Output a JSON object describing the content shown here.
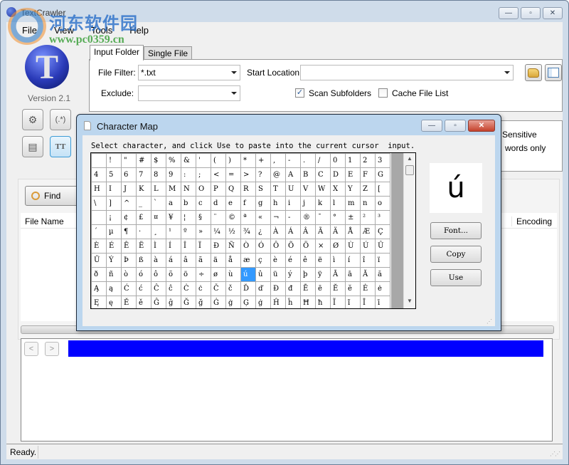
{
  "window": {
    "title": "TextCrawler",
    "minimize_label": "—",
    "maximize_label": "▫",
    "close_label": "✕"
  },
  "watermark": {
    "cn_text": "河东软件园",
    "url": "www.pc0359.cn"
  },
  "menu": [
    "File",
    "View",
    "Tools",
    "Help"
  ],
  "app": {
    "logo_letter": "T",
    "version": "Version 2.1"
  },
  "tools": [
    {
      "name": "settings",
      "glyph": "⚙"
    },
    {
      "name": "regex",
      "glyph": "(.*)"
    },
    {
      "name": "document",
      "glyph": "▤"
    },
    {
      "name": "character-map",
      "glyph": "TT"
    }
  ],
  "tabs": [
    {
      "label": "Input Folder",
      "active": true
    },
    {
      "label": "Single File",
      "active": false
    }
  ],
  "input_folder": {
    "file_filter_label": "File Filter:",
    "file_filter_value": "*.txt",
    "exclude_label": "Exclude:",
    "exclude_value": "",
    "start_location_label": "Start Location:",
    "start_location_value": "",
    "scan_subfolders_label": "Scan Subfolders",
    "scan_subfolders_checked": true,
    "cache_file_list_label": "Cache File List",
    "cache_file_list_checked": false
  },
  "options": {
    "case_sensitive_partial": "Sensitive",
    "whole_words_partial": "words only"
  },
  "find": {
    "label": "Find"
  },
  "results": {
    "columns": [
      "File Name",
      "Encoding"
    ]
  },
  "preview": {
    "prev_label": "<",
    "next_label": ">"
  },
  "status": {
    "text": "Ready."
  },
  "charmap": {
    "title": "Character Map",
    "instruction": "Select character, and click Use to paste into the current cursor  input.",
    "selected_char": "ú",
    "selected_row": 8,
    "selected_col": 10,
    "rows": [
      [
        " ",
        "!",
        "\"",
        "#",
        "$",
        "%",
        "&",
        "'",
        "(",
        ")",
        "*",
        "+",
        ",",
        "-",
        ".",
        "/",
        "0",
        "1",
        "2",
        "3"
      ],
      [
        "4",
        "5",
        "6",
        "7",
        "8",
        "9",
        ":",
        ";",
        "<",
        "=",
        ">",
        "?",
        "@",
        "A",
        "B",
        "C",
        "D",
        "E",
        "F",
        "G"
      ],
      [
        "H",
        "I",
        "J",
        "K",
        "L",
        "M",
        "N",
        "O",
        "P",
        "Q",
        "R",
        "S",
        "T",
        "U",
        "V",
        "W",
        "X",
        "Y",
        "Z",
        "["
      ],
      [
        "\\",
        "]",
        "^",
        "_",
        "`",
        "a",
        "b",
        "c",
        "d",
        "e",
        "f",
        "g",
        "h",
        "i",
        "j",
        "k",
        "l",
        "m",
        "n",
        "o"
      ],
      [
        " ",
        "¡",
        "¢",
        "£",
        "¤",
        "¥",
        "¦",
        "§",
        "¨",
        "©",
        "ª",
        "«",
        "¬",
        "-",
        "®",
        "¯",
        "°",
        "±",
        "²",
        "³"
      ],
      [
        "´",
        "µ",
        "¶",
        "·",
        "¸",
        "¹",
        "º",
        "»",
        "¼",
        "½",
        "¾",
        "¿",
        "À",
        "Á",
        "Â",
        "Ã",
        "Ä",
        "Å",
        "Æ",
        "Ç"
      ],
      [
        "È",
        "É",
        "Ê",
        "Ë",
        "Ì",
        "Í",
        "Î",
        "Ï",
        "Ð",
        "Ñ",
        "Ò",
        "Ó",
        "Ô",
        "Õ",
        "Ö",
        "×",
        "Ø",
        "Ù",
        "Ú",
        "Û"
      ],
      [
        "Ü",
        "Ý",
        "Þ",
        "ß",
        "à",
        "á",
        "â",
        "ã",
        "ä",
        "å",
        "æ",
        "ç",
        "è",
        "é",
        "ê",
        "ë",
        "ì",
        "í",
        "î",
        "ï"
      ],
      [
        "ð",
        "ñ",
        "ò",
        "ó",
        "ô",
        "õ",
        "ö",
        "÷",
        "ø",
        "ù",
        "ú",
        "û",
        "ü",
        "ý",
        "þ",
        "ÿ",
        "Ā",
        "ā",
        "Ă",
        "ă"
      ],
      [
        "Ą",
        "ą",
        "Ć",
        "ć",
        "Ĉ",
        "ĉ",
        "Ċ",
        "ċ",
        "Č",
        "č",
        "Ď",
        "ď",
        "Đ",
        "đ",
        "Ē",
        "ē",
        "Ĕ",
        "ĕ",
        "Ė",
        "ė"
      ],
      [
        "Ę",
        "ę",
        "Ě",
        "ě",
        "Ĝ",
        "ĝ",
        "Ğ",
        "ğ",
        "Ġ",
        "ġ",
        "Ģ",
        "ģ",
        "Ĥ",
        "ĥ",
        "Ħ",
        "ħ",
        "Ĩ",
        "ĩ",
        "Ī",
        "ī"
      ]
    ],
    "font_button": "Font...",
    "copy_button": "Copy",
    "use_button": "Use"
  }
}
